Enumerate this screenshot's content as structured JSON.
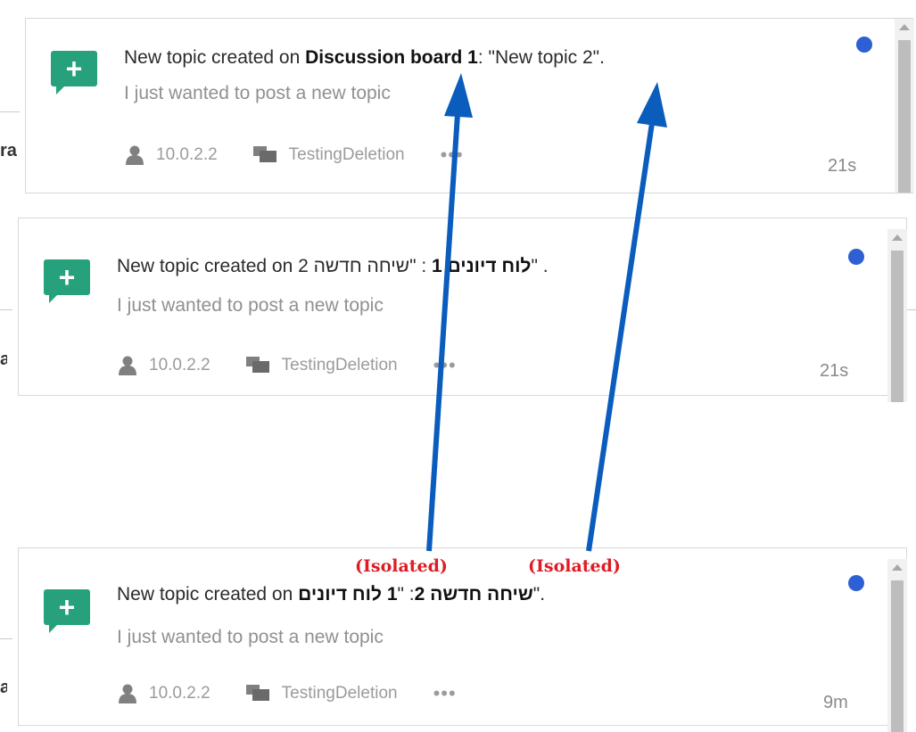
{
  "cards": [
    {
      "title_prefix": "New topic created on ",
      "board_name": "Discussion board 1",
      "title_middle": ": \"New topic 2\".",
      "body": "I just wanted to post a new topic",
      "user": "10.0.2.2",
      "group": "TestingDeletion",
      "more": "•••",
      "time": "21s",
      "edge_letter": "ra"
    },
    {
      "title_prefix": "New topic created on 2 שיחה חדשה\" :",
      "board_name": "לוח דיונים 1",
      "title_middle": "\" .",
      "body": "I just wanted to post a new topic",
      "user": "10.0.2.2",
      "group": "TestingDeletion",
      "more": "•••",
      "time": "21s",
      "edge_letter": "a"
    },
    {
      "title_prefix": "New topic created on ",
      "board_name": "1 לוח דיונים",
      "title_middle": "\" :",
      "title_topic": "שיחה חדשה 2",
      "title_suffix": "\".",
      "body": "I just wanted to post a new topic",
      "user": "10.0.2.2",
      "group": "TestingDeletion",
      "more": "•••",
      "time": "9m",
      "edge_letter": "a"
    }
  ],
  "annotations": {
    "left_label": "(Isolated)",
    "right_label": "(Isolated)",
    "arrow_color": "#0a5cbd",
    "label_color": "#e01b24"
  },
  "colors": {
    "icon_green": "#26a17b",
    "unread_blue": "#2e5fd3"
  },
  "icons": {
    "app": "plus-icon",
    "user": "user-icon",
    "group": "chat-icon",
    "more": "ellipsis-icon",
    "unread": "unread-dot-icon"
  }
}
